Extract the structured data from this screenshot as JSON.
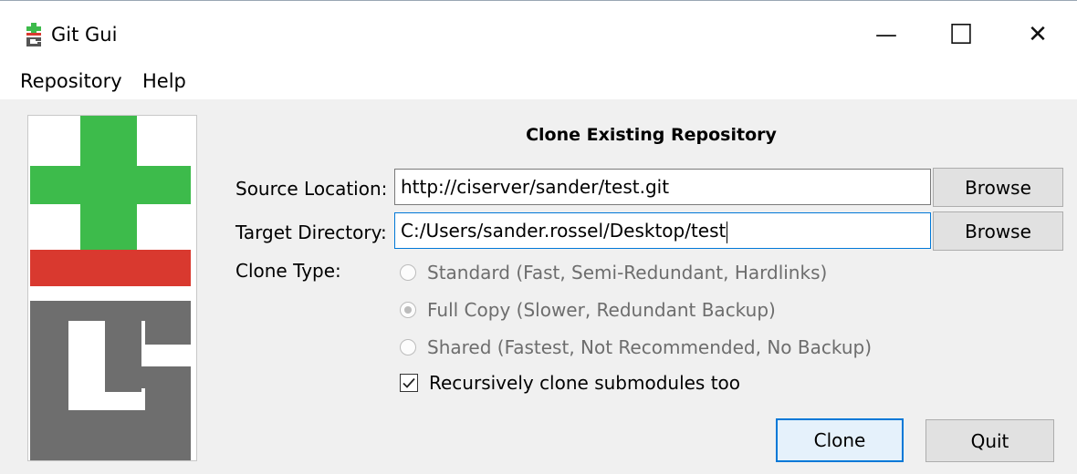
{
  "window": {
    "title": "Git Gui",
    "controls": {
      "minimize": "—",
      "maximize": "☐",
      "close": "✕"
    }
  },
  "menu": {
    "items": [
      "Repository",
      "Help"
    ]
  },
  "logo": {
    "colors": {
      "plus": "#3dbb4b",
      "bar": "#d9392f",
      "g": "#6e6e6e"
    }
  },
  "dialog": {
    "heading": "Clone Existing Repository",
    "source": {
      "label": "Source Location:",
      "value": "http://ciserver/sander/test.git",
      "browse_label": "Browse"
    },
    "target": {
      "label": "Target Directory:",
      "value": "C:/Users/sander.rossel/Desktop/test",
      "browse_label": "Browse"
    },
    "clone_type": {
      "label": "Clone Type:",
      "options": [
        {
          "label": "Standard (Fast, Semi-Redundant, Hardlinks)",
          "selected": false,
          "enabled": false
        },
        {
          "label": "Full Copy (Slower, Redundant Backup)",
          "selected": true,
          "enabled": false
        },
        {
          "label": "Shared (Fastest, Not Recommended, No Backup)",
          "selected": false,
          "enabled": false
        }
      ]
    },
    "submodules": {
      "label": "Recursively clone submodules too",
      "checked": true
    },
    "buttons": {
      "clone": "Clone",
      "quit": "Quit"
    }
  },
  "accent_color": "#0078d7"
}
